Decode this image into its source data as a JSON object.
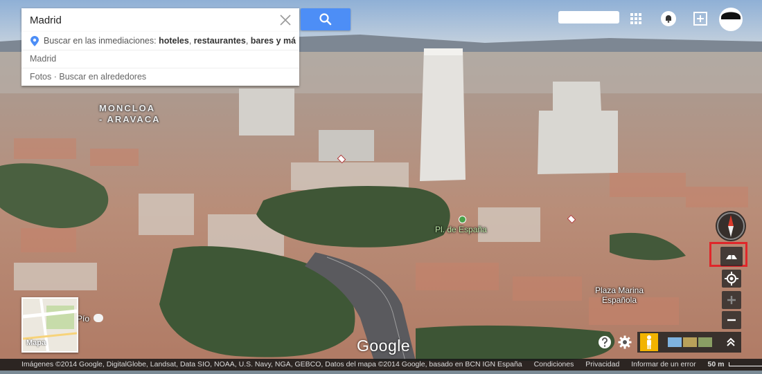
{
  "search": {
    "value": "Madrid",
    "suggestions": {
      "nearby_prefix": "Buscar en las inmediaciones: ",
      "nearby_hotels": "hoteles",
      "nearby_sep1": ", ",
      "nearby_restaurants": "restaurantes",
      "nearby_sep2": ", ",
      "nearby_bars": "bares y má",
      "place": "Madrid",
      "photos": "Fotos · Buscar en alrededores"
    }
  },
  "map": {
    "labels": {
      "district_line1": "MONCLOA",
      "district_line2": "- ARAVACA",
      "plaza_espana": "Pl. de España",
      "plaza_marina_line1": "Plaza Marina",
      "plaza_marina_line2": "Española",
      "pio": "Pío"
    },
    "logo": "Google",
    "minimap_label": "Mapa"
  },
  "footer": {
    "attribution": "Imágenes ©2014 Google, DigitalGlobe, Landsat, Data SIO, NOAA, U.S. Navy, NGA, GEBCO, Datos del mapa ©2014 Google, basado en BCN IGN España",
    "conditions": "Condiciones",
    "privacy": "Privacidad",
    "report": "Informar de un error",
    "scale": "50 m"
  },
  "colors": {
    "search_button": "#4d8ef6",
    "tilt_highlight": "#e0262a",
    "compass_north": "#d93a2b"
  }
}
